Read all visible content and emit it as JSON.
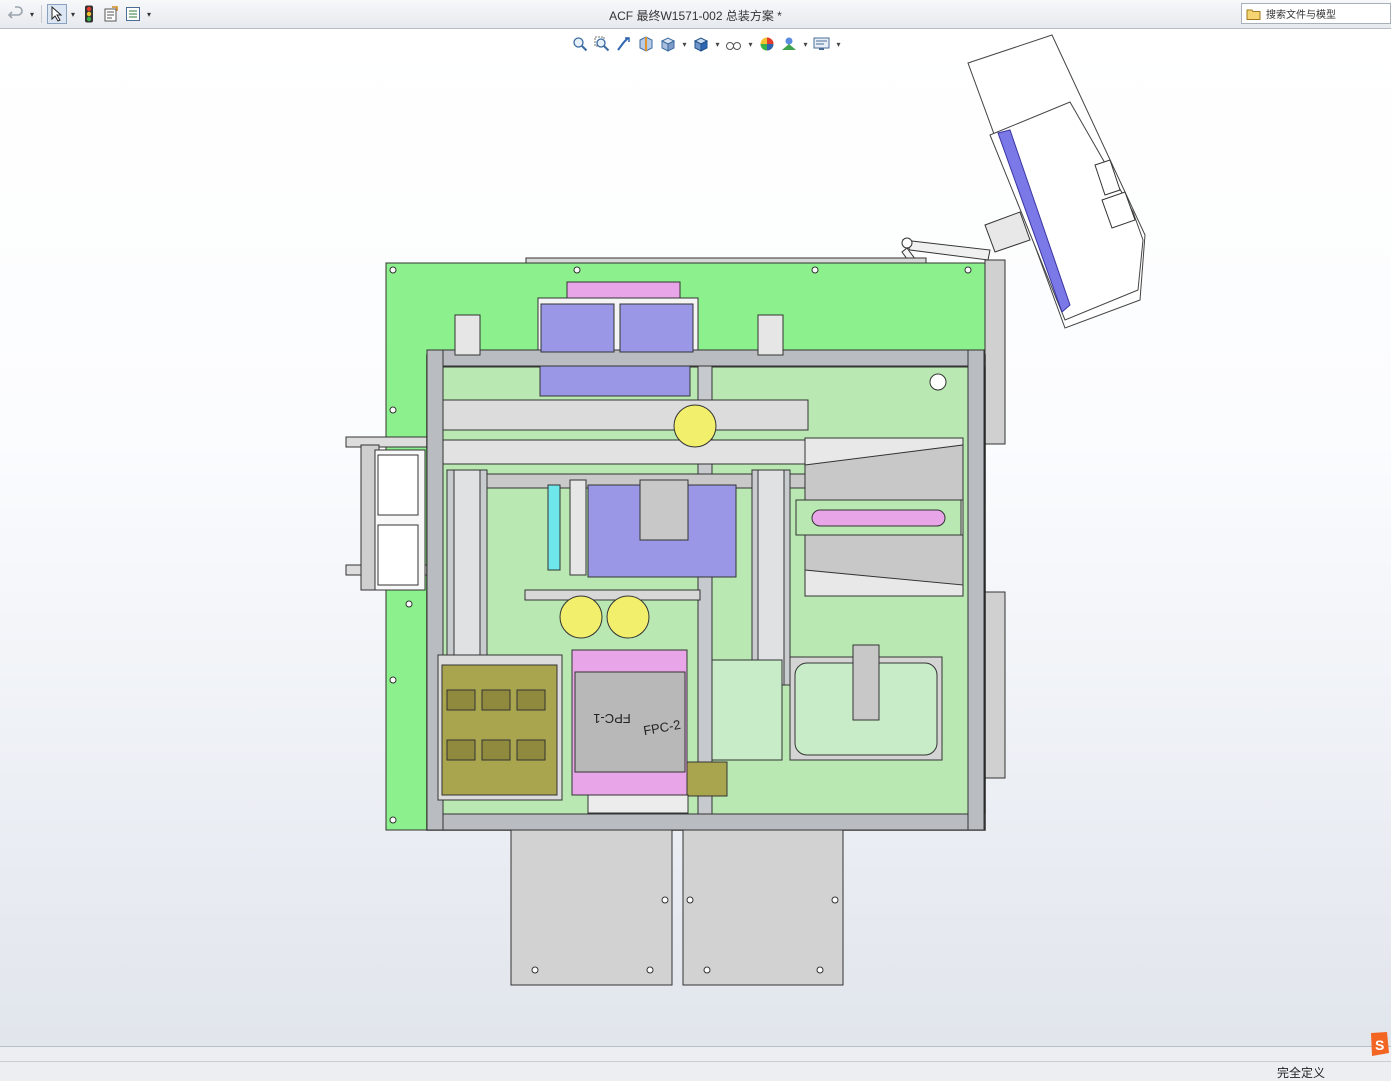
{
  "window": {
    "title": "ACF 最终W1571-002 总装方案 *"
  },
  "quick_access": {
    "icons": [
      "undo-icon",
      "select-arrow-icon",
      "rebuild-traffic-light-icon",
      "file-properties-icon",
      "options-list-icon"
    ]
  },
  "search": {
    "label": "搜索文件与模型",
    "icon": "folder-search-icon"
  },
  "heads_up_toolbar": {
    "icons": [
      "zoom-to-fit-icon",
      "zoom-to-area-icon",
      "previous-view-icon",
      "section-view-icon",
      "view-orientation-icon",
      "display-style-icon",
      "hide-show-items-icon",
      "edit-appearance-icon",
      "apply-scene-icon",
      "view-settings-icon"
    ]
  },
  "status_bar": {
    "definition_state": "完全定义"
  },
  "model": {
    "part_labels": [
      "FPC-1",
      "FPC-2"
    ],
    "colors": {
      "base_plate": "#8cf08c",
      "frame": "#b9bcc0",
      "lavender": "#9a98e6",
      "pink": "#e8a6e8",
      "yellow": "#f1ef6b",
      "olive": "#a9a44e",
      "light_green": "#b9e8b2",
      "cyan": "#6de7ea",
      "gray_panel": "#c8c8c8"
    }
  }
}
